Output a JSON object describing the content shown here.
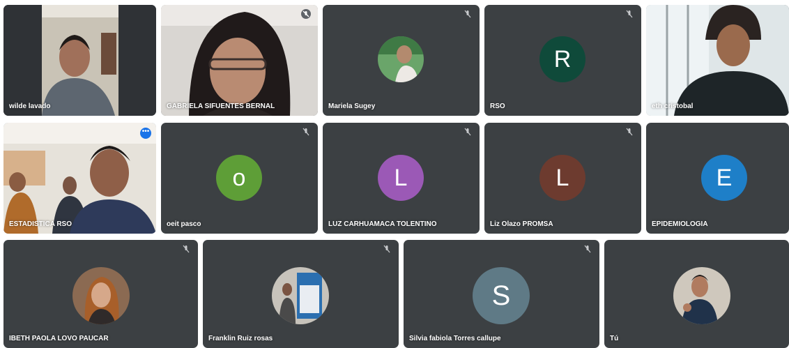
{
  "participants": [
    {
      "name": "wilde lavado",
      "type": "video"
    },
    {
      "name": "GABRIELA SIFUENTES BERNAL",
      "type": "video",
      "muted": true
    },
    {
      "name": "Mariela Sugey",
      "type": "photo",
      "muted": true
    },
    {
      "name": "RSO",
      "type": "initial",
      "initial": "R",
      "color": "#0f4a3a",
      "muted": true
    },
    {
      "name": "eth cristobal",
      "type": "video"
    },
    {
      "name": "ESTADISTICA RSO",
      "type": "video",
      "active": true
    },
    {
      "name": "oeit pasco",
      "type": "initial",
      "initial": "o",
      "color": "#5e9e37",
      "muted": true
    },
    {
      "name": "LUZ CARHUAMACA TOLENTINO",
      "type": "initial",
      "initial": "L",
      "color": "#9b59b6",
      "muted": true
    },
    {
      "name": "Liz Olazo PROMSA",
      "type": "initial",
      "initial": "L",
      "color": "#6d3b2f",
      "muted": true
    },
    {
      "name": "EPIDEMIOLOGIA",
      "type": "initial",
      "initial": "E",
      "color": "#1e7fc8"
    },
    {
      "name": "IBETH PAOLA LOVO PAUCAR",
      "type": "photo",
      "muted": true
    },
    {
      "name": "Franklin Ruiz rosas",
      "type": "photo",
      "muted": true
    },
    {
      "name": "Silvia fabiola Torres callupe",
      "type": "initial",
      "initial": "S",
      "color": "#5f7a86",
      "muted": true
    },
    {
      "name": "Tú",
      "type": "photo"
    }
  ],
  "icons": {
    "mic_off": "mic-off-icon",
    "more": "more-options-icon"
  }
}
